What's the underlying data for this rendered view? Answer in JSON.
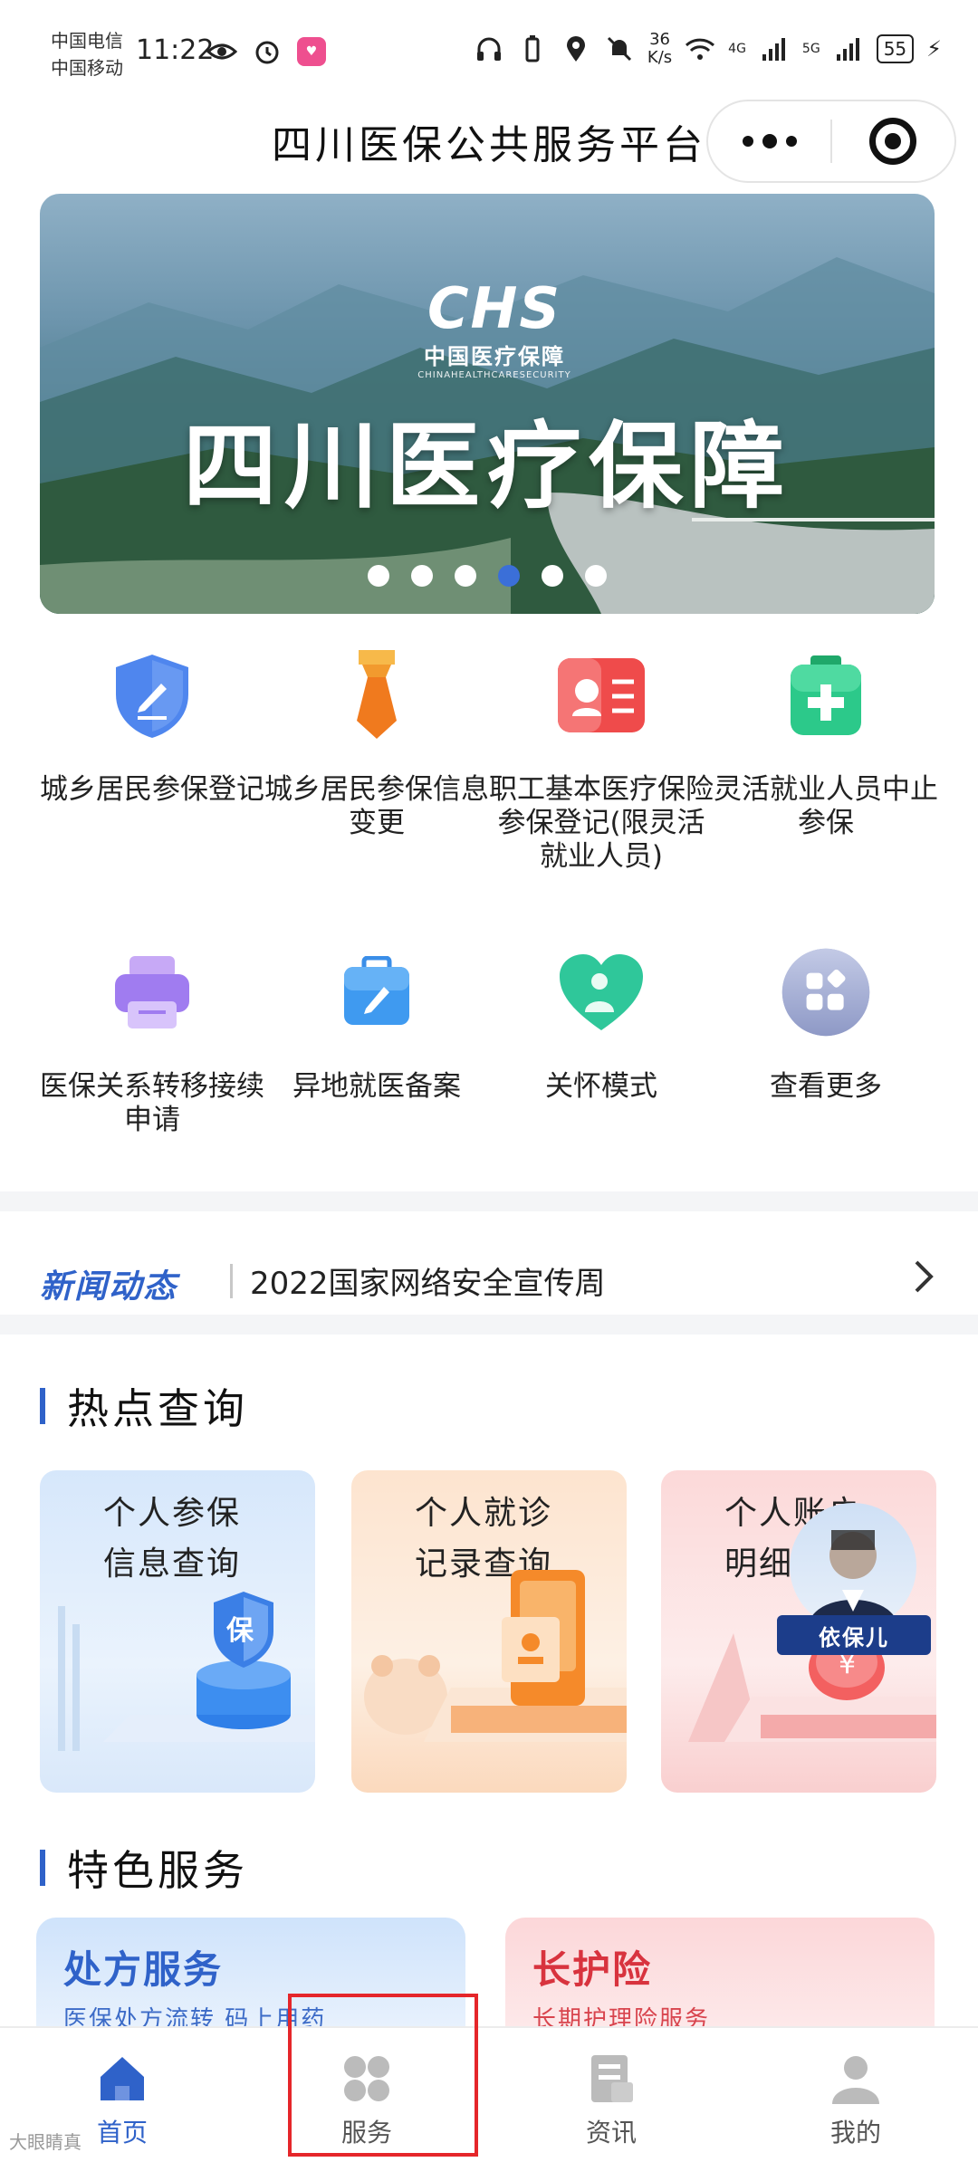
{
  "status_bar": {
    "carrier1": "中国电信",
    "carrier2": "中国移动",
    "time": "11:22",
    "speed_value": "36",
    "speed_unit": "K/s",
    "net1": "4G",
    "net2": "5G",
    "battery": "55"
  },
  "header": {
    "title": "四川医保公共服务平台"
  },
  "banner": {
    "logo_mark": "CHS",
    "logo_cn": "中国医疗保障",
    "logo_en": "CHINAHEALTHCARESECURITY",
    "title": "四川医疗保障",
    "slides": 6,
    "active_slide": 4
  },
  "services": [
    {
      "label": "城乡居民参保登记",
      "icon": "shield-edit-icon"
    },
    {
      "label": "城乡居民参保信息变更",
      "icon": "tie-icon"
    },
    {
      "label": "职工基本医疗保险参保登记(限灵活就业人员)",
      "icon": "record-icon"
    },
    {
      "label": "灵活就业人员中止参保",
      "icon": "medical-kit-icon"
    },
    {
      "label": "医保关系转移接续申请",
      "icon": "printer-icon"
    },
    {
      "label": "异地就医备案",
      "icon": "briefcase-edit-icon"
    },
    {
      "label": "关怀模式",
      "icon": "care-heart-icon"
    },
    {
      "label": "查看更多",
      "icon": "more-grid-icon"
    }
  ],
  "news": {
    "tag": "新闻动态",
    "headline": "2022国家网络安全宣传周"
  },
  "hot_query": {
    "title": "热点查询",
    "cards": [
      {
        "line1": "个人参保",
        "line2": "信息查询",
        "badge": "保"
      },
      {
        "line1": "个人就诊",
        "line2": "记录查询"
      },
      {
        "line1": "个人账户",
        "line2": "明细"
      }
    ]
  },
  "assistant": {
    "name": "依保儿"
  },
  "featured": {
    "title": "特色服务",
    "cards": [
      {
        "title": "处方服务",
        "subtitle": "医保处方流转 码上用药"
      },
      {
        "title": "长护险",
        "subtitle": "长期护理险服务"
      }
    ]
  },
  "tabbar": [
    {
      "label": "首页",
      "active": true
    },
    {
      "label": "服务",
      "active": false
    },
    {
      "label": "资讯",
      "active": false
    },
    {
      "label": "我的",
      "active": false
    }
  ],
  "watermark": "大眼睛真",
  "colors": {
    "primary": "#2f62c9",
    "highlight": "#e5262a"
  }
}
